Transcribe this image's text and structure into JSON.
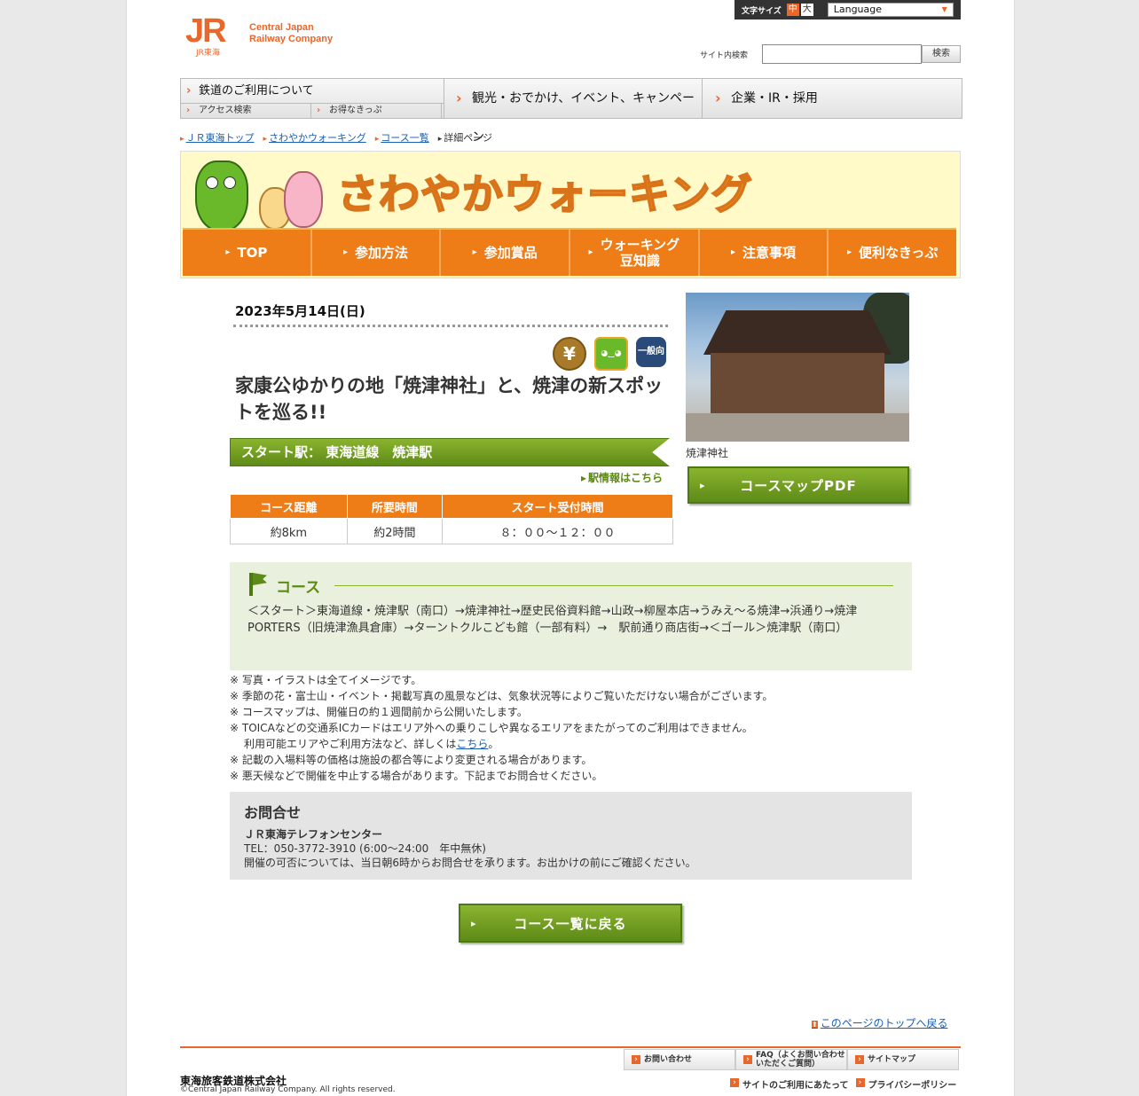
{
  "header": {
    "logo_mark": "JR",
    "logo_sub": "JR東海",
    "logo_line1": "Central Japan",
    "logo_line2": "Railway Company",
    "fontsize_label": "文字サイズ",
    "fontsize_mid": "中",
    "fontsize_big": "大",
    "language_value": "Language",
    "search_label": "サイト内検索",
    "search_placeholder": "",
    "search_button": "検索"
  },
  "gnav": {
    "main1": "鉄道のご利用について",
    "sub1": "アクセス検索",
    "sub2": "お得なきっぷ",
    "main2": "観光・おでかけ、イベント、キャンペーン",
    "main3": "企業・IR・採用"
  },
  "breadcrumb": {
    "item1": "ＪＲ東海トップ",
    "item2": "さわやかウォーキング",
    "item3": "コース一覧",
    "current": "詳細ページ"
  },
  "banner": {
    "title": "さわやかウォーキング",
    "nav": [
      "TOP",
      "参加方法",
      "参加賞品",
      "ウォーキング\n豆知識",
      "注意事項",
      "便利なきっぷ"
    ]
  },
  "event": {
    "date": "2023年5月14日(日)",
    "icon_yen": "¥",
    "icon_hex": "一般向",
    "title": "家康公ゆかりの地「焼津神社」と、焼津の新スポットを巡る!!",
    "start_station": "スタート駅： 東海道線　焼津駅",
    "station_link": "駅情報はこちら",
    "table_headers": [
      "コース距離",
      "所要時間",
      "スタート受付時間"
    ],
    "table_values": [
      "約8km",
      "約2時間",
      "８：００～１２：００"
    ],
    "photo_caption": "焼津神社",
    "pdf_button": "コースマップPDF"
  },
  "course": {
    "heading": "コース",
    "route": "＜スタート＞東海道線・焼津駅（南口）→焼津神社→歴史民俗資料館→山政→柳屋本店→うみえ～る焼津→浜通り→焼津PORTERS（旧焼津漁具倉庫）→ターントクルこども館（一部有料）→　駅前通り商店街→＜ゴール＞焼津駅（南口）"
  },
  "notes": {
    "n1": "※ 写真・イラストは全てイメージです。",
    "n2": "※ 季節の花・富士山・イベント・掲載写真の風景などは、気象状況等によりご覧いただけない場合がございます。",
    "n3": "※ コースマップは、開催日の約１週間前から公開いたします。",
    "n4": "※ TOICAなどの交通系ICカードはエリア外への乗りこしや異なるエリアをまたがってのご利用はできません。",
    "n4b_pre": "利用可能エリアやご利用方法など、詳しくは",
    "n4b_link": "こちら",
    "n4b_post": "。",
    "n5": "※ 記載の入場料等の価格は施設の都合等により変更される場合があります。",
    "n6": "※ 悪天候などで開催を中止する場合があります。下記までお問合せください。"
  },
  "contact": {
    "heading": "お問合せ",
    "name": "ＪＲ東海テレフォンセンター",
    "tel": "TEL：050-3772-3910 (6:00～24:00　年中無休)",
    "note": "開催の可否については、当日朝6時からお問合せを承ります。お出かけの前にご確認ください。"
  },
  "back_button": "コース一覧に戻る",
  "footer": {
    "pagetop": "このページのトップへ戻る",
    "company": "東海旅客鉄道株式会社",
    "copyright": "©Central Japan Railway Company. All rights reserved.",
    "nav1": "お問い合わせ",
    "nav2": "FAQ（よくお問い合わせいただくご質問）",
    "nav3": "サイトマップ",
    "sub1": "サイトのご利用にあたって",
    "sub2": "プライバシーポリシー"
  },
  "colors": {
    "brand_orange": "#e8672a",
    "walking_orange": "#ee7d18",
    "walking_green": "#5e8a18"
  }
}
